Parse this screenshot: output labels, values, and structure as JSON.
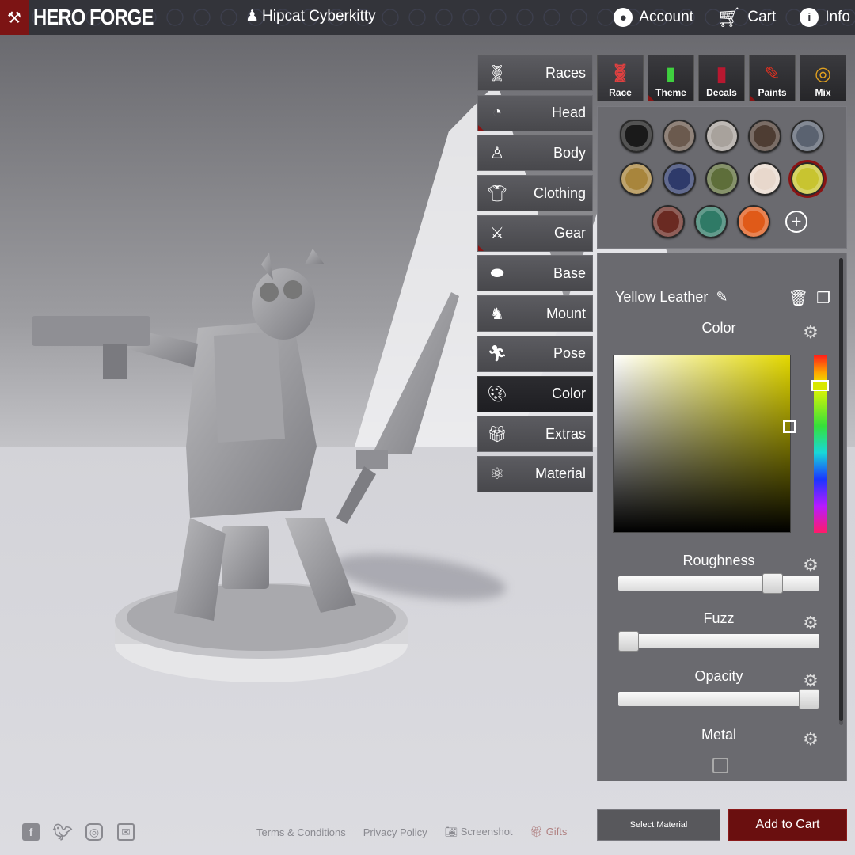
{
  "topbar": {
    "logo_text": "HERO FORGE",
    "character_name": "Hipcat Cyberkitty",
    "nav": [
      {
        "label": "Account",
        "icon": "account-icon"
      },
      {
        "label": "Cart",
        "icon": "cart-icon"
      },
      {
        "label": "Info",
        "icon": "info-icon"
      }
    ]
  },
  "categories": [
    {
      "label": "Races",
      "icon": "dna-icon",
      "active": false
    },
    {
      "label": "Head",
      "icon": "head-icon",
      "active": false
    },
    {
      "label": "Body",
      "icon": "body-icon",
      "active": false
    },
    {
      "label": "Clothing",
      "icon": "shirt-icon",
      "active": false
    },
    {
      "label": "Gear",
      "icon": "sword-icon",
      "active": false
    },
    {
      "label": "Base",
      "icon": "base-icon",
      "active": false
    },
    {
      "label": "Mount",
      "icon": "horse-icon",
      "active": false
    },
    {
      "label": "Pose",
      "icon": "pose-icon",
      "active": false
    },
    {
      "label": "Color",
      "icon": "palette-icon",
      "active": true
    },
    {
      "label": "Extras",
      "icon": "gift-icon",
      "active": false
    },
    {
      "label": "Material",
      "icon": "material-icon",
      "active": false
    }
  ],
  "tabs": [
    {
      "label": "Race",
      "icon": "dna-icon"
    },
    {
      "label": "Theme",
      "icon": "paint-roller-icon"
    },
    {
      "label": "Decals",
      "icon": "decal-icon"
    },
    {
      "label": "Paints",
      "icon": "brush-icon"
    },
    {
      "label": "Mix",
      "icon": "mix-icon"
    }
  ],
  "swatches": [
    {
      "name": "black-hair",
      "color": "#1a1a1a"
    },
    {
      "name": "bronze",
      "color": "#6b5a4e"
    },
    {
      "name": "silver",
      "color": "#a8a29c"
    },
    {
      "name": "dark-bronze",
      "color": "#4e3d33"
    },
    {
      "name": "steel",
      "color": "#5a6270"
    },
    {
      "name": "gold",
      "color": "#a8853c"
    },
    {
      "name": "blue-metal",
      "color": "#2e3a6a"
    },
    {
      "name": "green-metal",
      "color": "#5e6e3a"
    },
    {
      "name": "skin",
      "color": "#e8d8cc"
    },
    {
      "name": "yellow-leather",
      "color": "#c8c430",
      "selected": true
    },
    {
      "name": "red-hair",
      "color": "#6a2a22"
    },
    {
      "name": "teal",
      "color": "#2f7a66"
    },
    {
      "name": "flame",
      "color": "#e05a18"
    }
  ],
  "material": {
    "name": "Yellow Leather",
    "color_label": "Color",
    "picked_color": "#d6cc00",
    "roughness_label": "Roughness",
    "roughness": 0.8,
    "fuzz_label": "Fuzz",
    "fuzz": 0.0,
    "opacity_label": "Opacity",
    "opacity": 1.0,
    "metal_label": "Metal",
    "metal": false
  },
  "actions": {
    "select_material": "Select Material",
    "add_to_cart": "Add to Cart"
  },
  "footer": {
    "social": [
      "facebook-icon",
      "twitter-icon",
      "instagram-icon",
      "mail-icon"
    ],
    "links": [
      "Terms & Conditions",
      "Privacy Policy",
      "Screenshot",
      "Gifts"
    ]
  }
}
